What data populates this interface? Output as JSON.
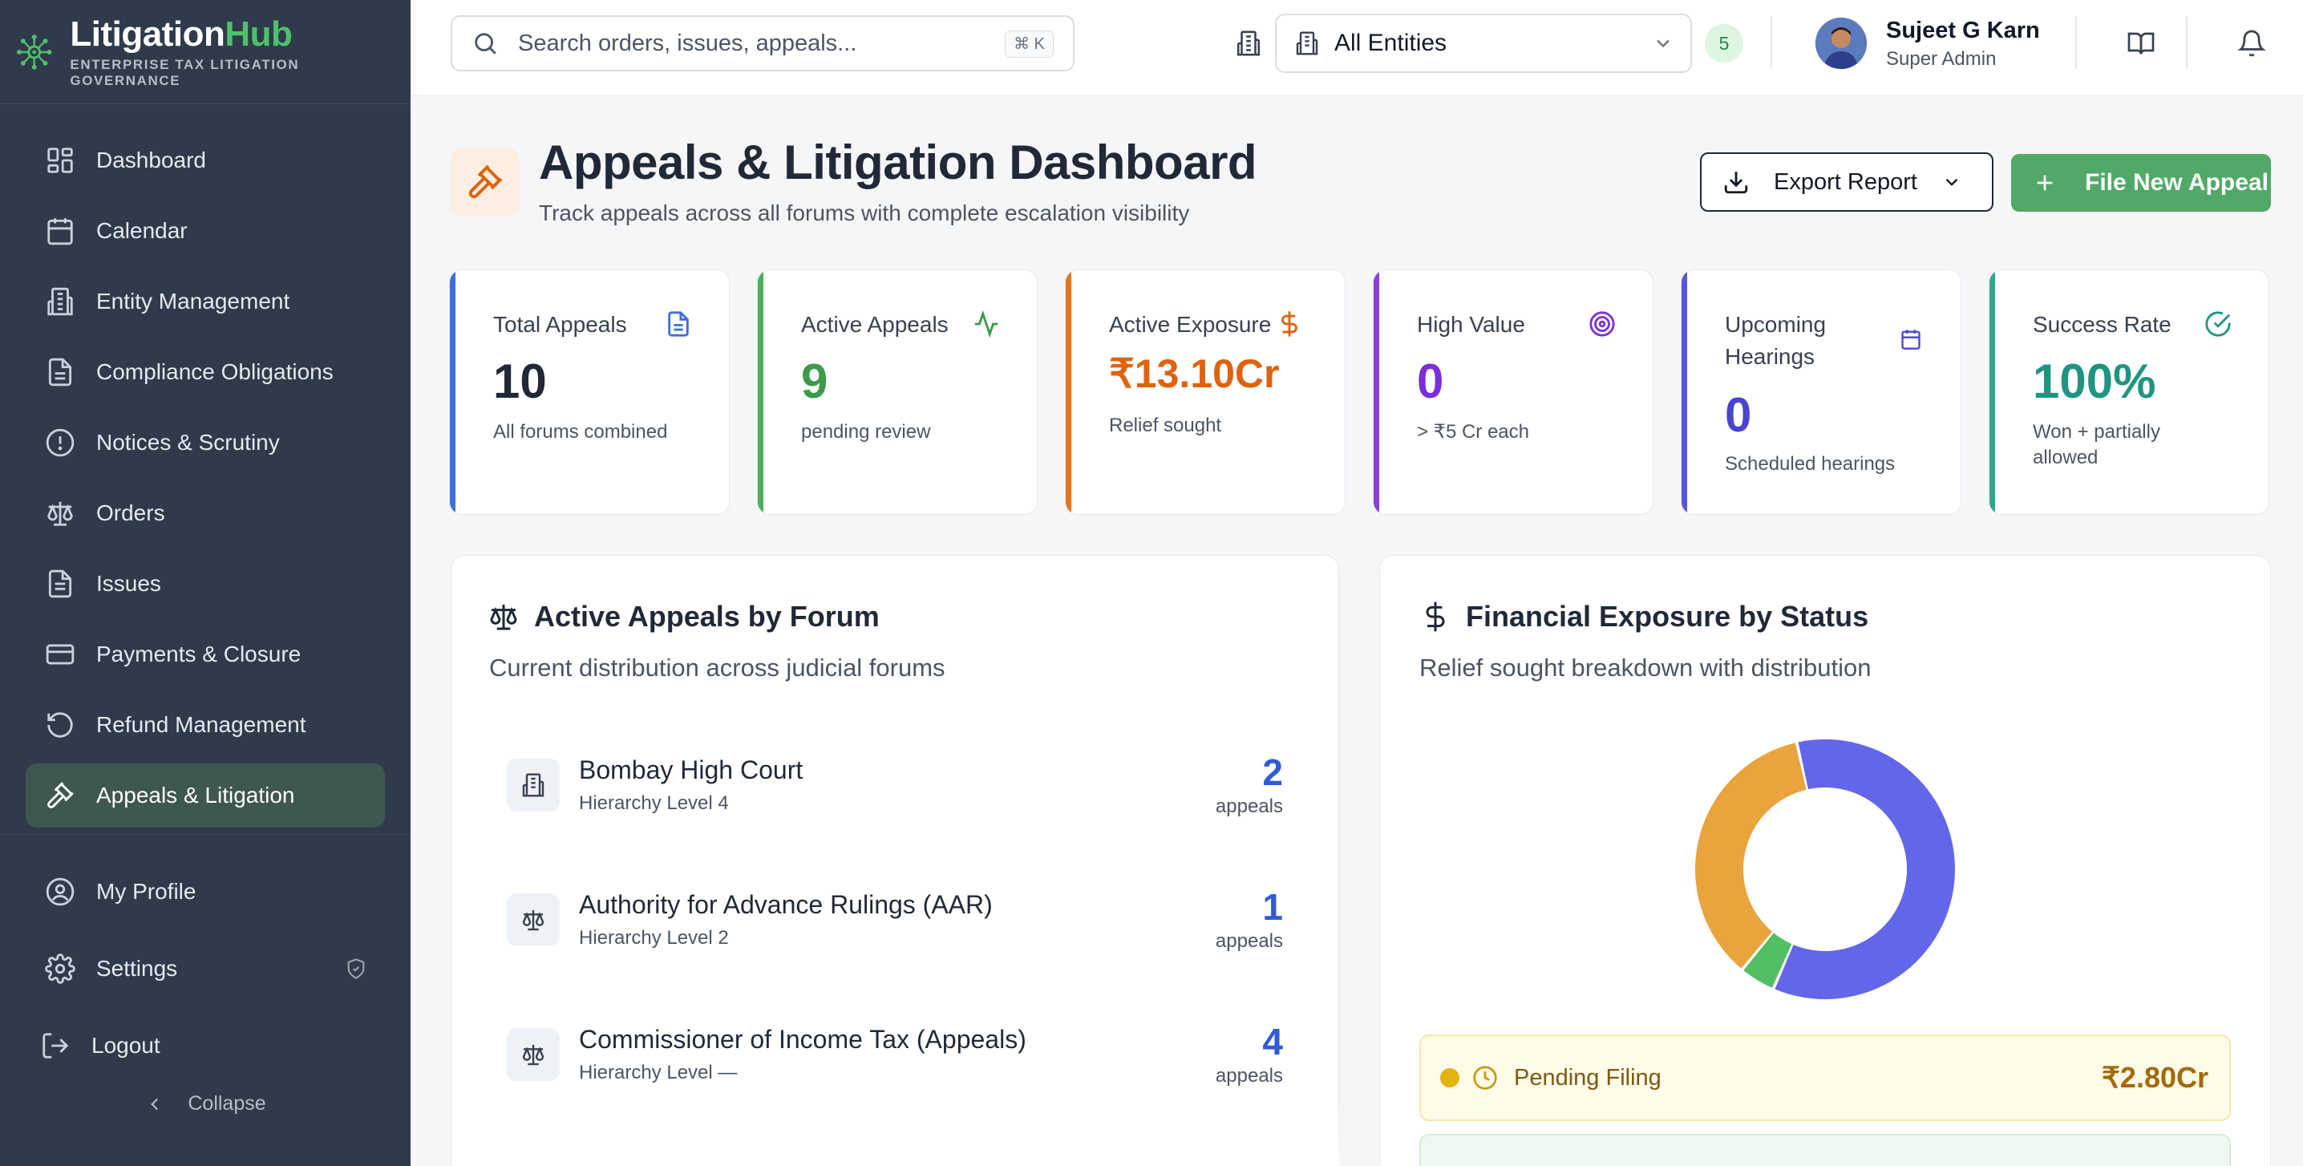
{
  "brand": {
    "name_main": "Litigation",
    "name_accent": "Hub",
    "tagline": "ENTERPRISE TAX LITIGATION GOVERNANCE"
  },
  "sidebar": {
    "items": [
      {
        "label": "Dashboard",
        "icon": "dashboard-icon"
      },
      {
        "label": "Calendar",
        "icon": "calendar-icon"
      },
      {
        "label": "Entity Management",
        "icon": "building-icon"
      },
      {
        "label": "Compliance Obligations",
        "icon": "document-icon"
      },
      {
        "label": "Notices & Scrutiny",
        "icon": "alert-circle-icon"
      },
      {
        "label": "Orders",
        "icon": "scale-icon"
      },
      {
        "label": "Issues",
        "icon": "file-text-icon"
      },
      {
        "label": "Payments & Closure",
        "icon": "credit-card-icon"
      },
      {
        "label": "Refund Management",
        "icon": "refund-icon"
      },
      {
        "label": "Appeals & Litigation",
        "icon": "gavel-icon",
        "active": true
      }
    ],
    "bottom": [
      {
        "label": "My Profile",
        "icon": "user-circle-icon"
      },
      {
        "label": "Settings",
        "icon": "gear-icon"
      },
      {
        "label": "Logout",
        "icon": "logout-icon"
      }
    ],
    "collapse_label": "Collapse"
  },
  "topbar": {
    "search_placeholder": "Search orders, issues, appeals...",
    "search_shortcut": "⌘ K",
    "entity_selected": "All Entities",
    "entity_count": "5",
    "user_name": "Sujeet G Karn",
    "user_role": "Super Admin"
  },
  "header": {
    "title": "Appeals & Litigation Dashboard",
    "subtitle": "Track appeals across all forums with complete escalation visibility",
    "export_label": "Export Report",
    "new_appeal_label": "File New Appeal"
  },
  "stats": [
    {
      "label": "Total Appeals",
      "value": "10",
      "sub": "All forums combined",
      "color": "#3b6fe0",
      "value_color": "#1f2937"
    },
    {
      "label": "Active Appeals",
      "value": "9",
      "sub": "pending review",
      "color": "#4caf5a",
      "value_color": "#3c9a4b"
    },
    {
      "label": "Active Exposure",
      "value": "₹13.10Cr",
      "sub": "Relief sought",
      "color": "#e8751a",
      "value_color": "#e0620e"
    },
    {
      "label": "High Value",
      "value": "0",
      "sub": "> ₹5 Cr each",
      "color": "#8b3fe0",
      "value_color": "#7c2fd8"
    },
    {
      "label": "Upcoming Hearings",
      "value": "0",
      "sub": "Scheduled hearings",
      "color": "#5b54e0",
      "value_color": "#4a44d0"
    },
    {
      "label": "Success Rate",
      "value": "100%",
      "sub": "Won + partially allowed",
      "color": "#2fa88e",
      "value_color": "#1f9581"
    }
  ],
  "forum_panel": {
    "title": "Active Appeals by Forum",
    "subtitle": "Current distribution across judicial forums",
    "unit": "appeals",
    "forums": [
      {
        "name": "Bombay High Court",
        "level": "Hierarchy Level 4",
        "count": "2",
        "icon": "building-icon"
      },
      {
        "name": "Authority for Advance Rulings (AAR)",
        "level": "Hierarchy Level 2",
        "count": "1",
        "icon": "scale-icon"
      },
      {
        "name": "Commissioner of Income Tax (Appeals)",
        "level": "Hierarchy Level —",
        "count": "4",
        "icon": "scale-icon"
      }
    ]
  },
  "exposure_panel": {
    "title": "Financial Exposure by Status",
    "subtitle": "Relief sought breakdown with distribution",
    "donut_segments": [
      {
        "color": "#6366e8",
        "fraction": 0.6
      },
      {
        "color": "#52bf62",
        "fraction": 0.045
      },
      {
        "color": "#e9a43e",
        "fraction": 0.355
      }
    ],
    "rows": [
      {
        "label": "Pending Filing",
        "amount": "₹2.80Cr",
        "dot_color": "#e3b30e"
      }
    ]
  }
}
